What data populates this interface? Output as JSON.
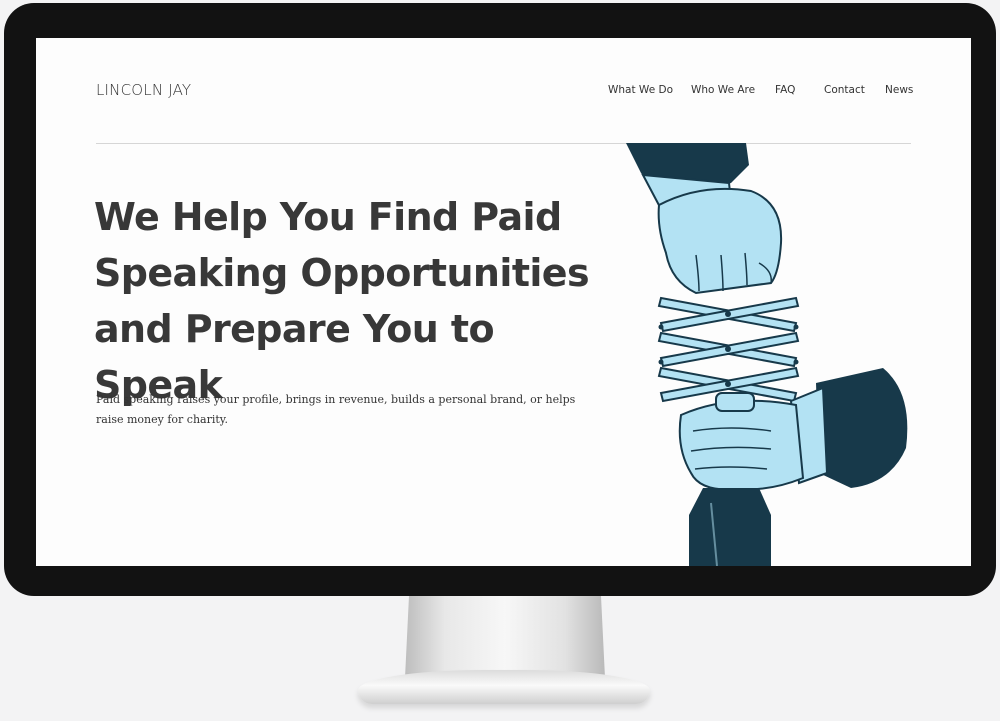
{
  "site": {
    "brand": "LINCOLN JAY",
    "nav": [
      "What We Do",
      "Who We Are",
      "FAQ",
      "Contact",
      "News"
    ]
  },
  "hero": {
    "title": "We Help You Find Paid Speaking Opportunities and Prepare You to Speak",
    "subtitle": "Paid speaking raises your profile, brings in revenue, builds a personal brand, or helps raise money for charity."
  },
  "colors": {
    "accent": "#b3e2f3",
    "ink": "#17394a",
    "heading": "#383838"
  },
  "illustration": "hands-scissor-extender-bottle-illustration"
}
